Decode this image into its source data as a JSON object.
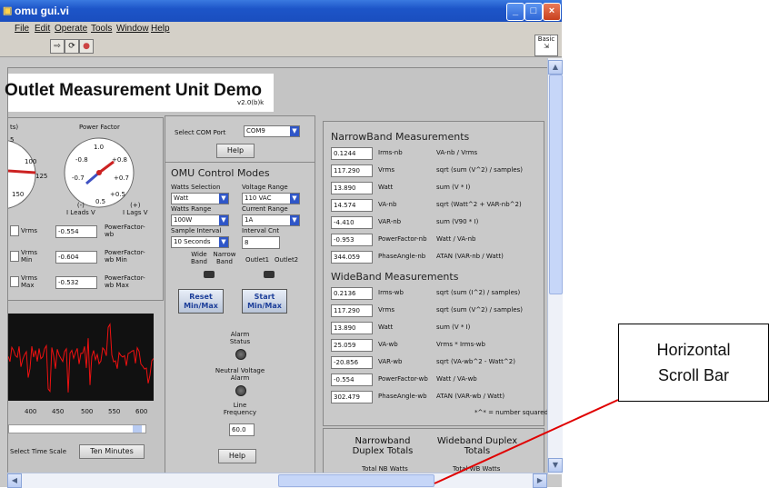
{
  "window": {
    "title": "omu gui.vi",
    "min_btn": "_",
    "max_btn": "□",
    "close_btn": "×"
  },
  "menu": [
    "File",
    "Edit",
    "Operate",
    "Tools",
    "Window",
    "Help"
  ],
  "toolbar": {
    "run": "⇨",
    "run_cont": "⟳",
    "abort": "●",
    "context_label": "Basic"
  },
  "panel": {
    "title": "Outlet Measurement Unit Demo",
    "version": "v2.0(b)k",
    "com_port_label": "Select COM Port",
    "com_port_value": "COM9",
    "help1": "Help",
    "gauge1": {
      "title": "ts)",
      "ticks": [
        "5",
        "100",
        "125",
        "150"
      ]
    },
    "gauge2": {
      "title": "Power Factor",
      "ticks": [
        "1.0",
        "-0.8",
        "+0.8",
        "-0.7",
        "+0.7",
        "+0.5",
        "0.5"
      ],
      "leads": "(-)\nI Leads V",
      "lags": "(+)\nI Lags V"
    },
    "readings": [
      {
        "label": "Vrms",
        "value": "-0.554",
        "side": "PowerFactor-wb"
      },
      {
        "label": "Vrms Min",
        "value": "-0.604",
        "side": "PowerFactor-wb Min"
      },
      {
        "label": "Vrms Max",
        "value": "-0.532",
        "side": "PowerFactor-wb Max"
      }
    ],
    "time_axis": [
      "400",
      "450",
      "500",
      "550",
      "600"
    ],
    "time_scale_label": "Select Time Scale",
    "time_scale_value": "Ten Minutes",
    "control": {
      "title": "OMU Control Modes",
      "watts_sel_label": "Watts Selection",
      "watts_sel": "Watt",
      "voltage_range_label": "Voltage Range",
      "voltage_range": "110 VAC",
      "watts_range_label": "Watts Range",
      "watts_range": "100W",
      "current_range_label": "Current Range",
      "current_range": "1A",
      "sample_interval_label": "Sample Interval",
      "sample_interval": "10 Seconds",
      "interval_cnt_label": "Interval Cnt",
      "interval_cnt": "8",
      "wide_band": "Wide Band",
      "narrow_band": "Narrow Band",
      "outlet1": "Outlet1",
      "outlet2": "Outlet2",
      "reset_btn": "Reset Min/Max",
      "start_btn": "Start Min/Max",
      "alarm_status": "Alarm Status",
      "neutral_alarm": "Neutral Voltage Alarm",
      "line_freq_label": "Line Frequency",
      "line_freq": "60.0",
      "help2": "Help"
    },
    "narrowband": {
      "title": "NarrowBand Measurements",
      "rows": [
        {
          "value": "0.1244",
          "name": "Irms-nb",
          "formula": "VA-nb / Vrms"
        },
        {
          "value": "117.290",
          "name": "Vrms",
          "formula": "sqrt (sum (V^2) / samples)"
        },
        {
          "value": "13.890",
          "name": "Watt",
          "formula": "sum (V * I)"
        },
        {
          "value": "14.574",
          "name": "VA-nb",
          "formula": "sqrt (Watt^2 + VAR-nb^2)"
        },
        {
          "value": "-4.410",
          "name": "VAR-nb",
          "formula": "sum (V90 * I)"
        },
        {
          "value": "-0.953",
          "name": "PowerFactor-nb",
          "formula": "Watt / VA-nb"
        },
        {
          "value": "344.059",
          "name": "PhaseAngle-nb",
          "formula": "ATAN (VAR-nb / Watt)"
        }
      ]
    },
    "wideband": {
      "title": "WideBand Measurements",
      "rows": [
        {
          "value": "0.2136",
          "name": "Irms-wb",
          "formula": "sqrt (sum (I^2) / samples)"
        },
        {
          "value": "117.290",
          "name": "Vrms",
          "formula": "sqrt (sum (V^2) / samples)"
        },
        {
          "value": "13.890",
          "name": "Watt",
          "formula": "sum (V * I)"
        },
        {
          "value": "25.059",
          "name": "VA-wb",
          "formula": "Vrms * Irms-wb"
        },
        {
          "value": "-20.856",
          "name": "VAR-wb",
          "formula": "sqrt (VA-wb^2 - Watt^2)"
        },
        {
          "value": "-0.554",
          "name": "PowerFactor-wb",
          "formula": "Watt / VA-wb"
        },
        {
          "value": "302.479",
          "name": "PhaseAngle-wb",
          "formula": "ATAN (VAR-wb / Watt)"
        }
      ],
      "note": "*^* = number squared"
    },
    "duplex": {
      "narrow_title": "Narrowband Duplex Totals",
      "narrow_sub": "Total NB Watts",
      "wide_title": "Wideband Duplex Totals",
      "wide_sub": "Total WB Watts"
    }
  },
  "callout": {
    "line1": "Horizontal",
    "line2": "Scroll Bar"
  }
}
